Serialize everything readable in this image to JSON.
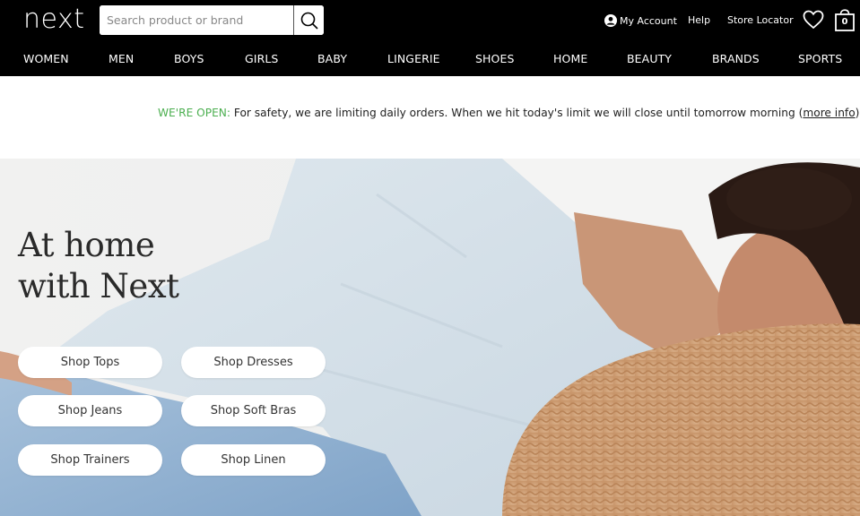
{
  "header": {
    "logo": "next",
    "search": {
      "placeholder": "Search product or brand",
      "value": ""
    },
    "utility": {
      "account": "My Account",
      "help": "Help",
      "store_locator": "Store Locator",
      "bag_count": "0"
    },
    "nav": [
      "WOMEN",
      "MEN",
      "BOYS",
      "GIRLS",
      "BABY",
      "LINGERIE",
      "SHOES",
      "HOME",
      "BEAUTY",
      "BRANDS",
      "SPORTS"
    ]
  },
  "banner": {
    "status": "WE'RE OPEN:",
    "message": " For safety, we are limiting daily orders. When we hit today's limit we will close until tomorrow morning (",
    "link": "more info",
    "suffix": ")."
  },
  "hero": {
    "title_line1": "At home",
    "title_line2": "with Next",
    "buttons": [
      "Shop Tops",
      "Shop Dresses",
      "Shop Jeans",
      "Shop Soft Bras",
      "Shop Trainers",
      "Shop Linen"
    ]
  },
  "colors": {
    "header_bg": "#000000",
    "open_green": "#4caf50"
  }
}
